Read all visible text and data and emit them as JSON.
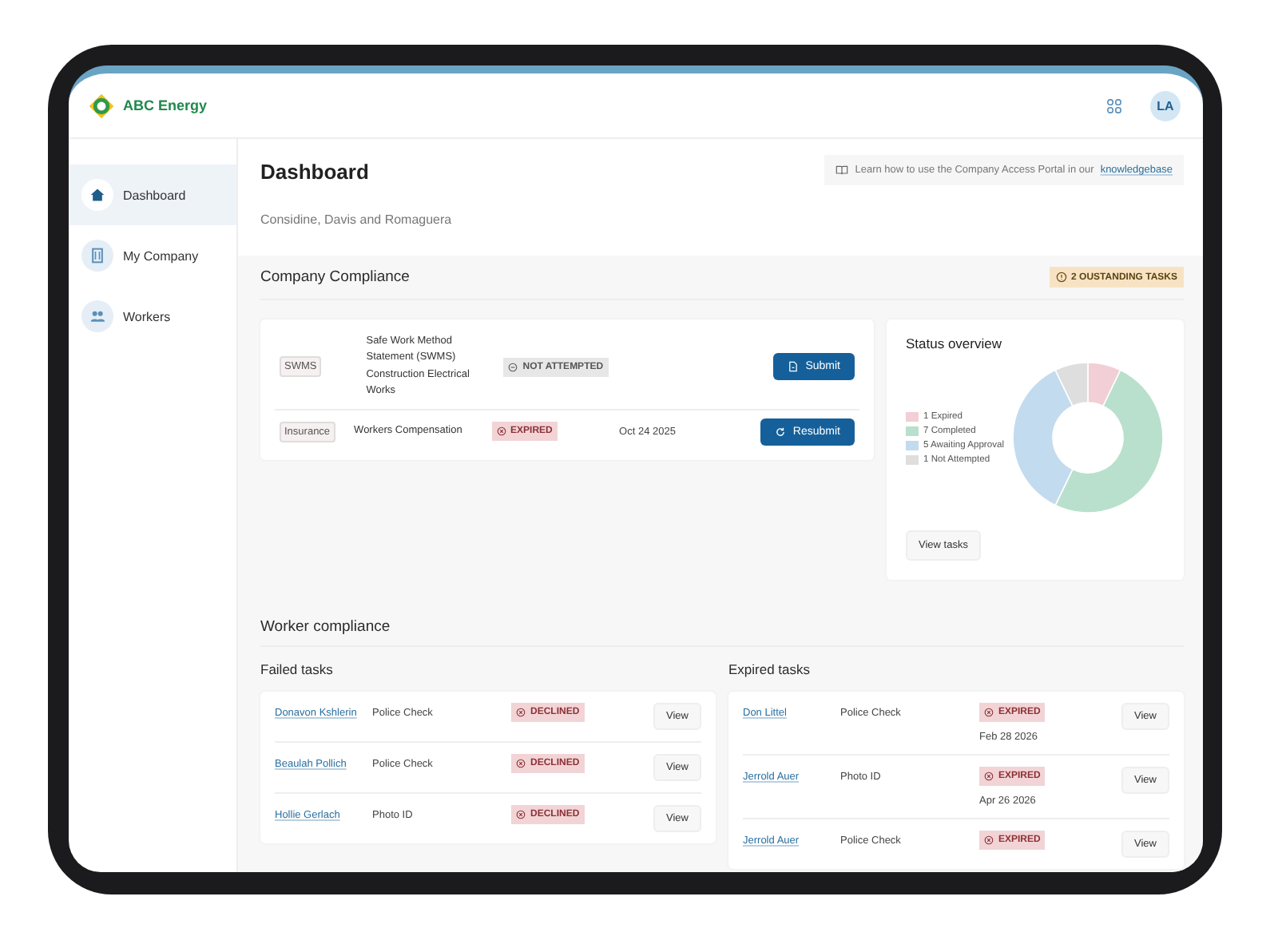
{
  "brand": {
    "name": "ABC Energy"
  },
  "user": {
    "initials": "LA"
  },
  "sidebar": {
    "items": [
      {
        "label": "Dashboard",
        "kind": "home",
        "selected": true
      },
      {
        "label": "My Company",
        "kind": "company",
        "selected": false
      },
      {
        "label": "Workers",
        "kind": "workers",
        "selected": false
      }
    ]
  },
  "header": {
    "title": "Dashboard",
    "subtitle": "Considine, Davis and Romaguera",
    "help": {
      "text": "Learn how to use the Company Access Portal in our",
      "link": "knowledgebase"
    }
  },
  "company_compliance": {
    "title": "Company Compliance",
    "badge": "2 OUSTANDING TASKS",
    "items": [
      {
        "category": "SWMS",
        "name": "Safe Work Method Statement (SWMS) Construction Electrical Works",
        "status": {
          "label": "NOT ATTEMPTED",
          "kind": "neutral"
        },
        "action": {
          "label": "Submit",
          "kind": "submit"
        }
      },
      {
        "category": "Insurance",
        "name": "Workers Compensation",
        "status": {
          "label": "EXPIRED",
          "kind": "danger"
        },
        "date": "Oct 24 2025",
        "action": {
          "label": "Resubmit",
          "kind": "resubmit"
        }
      }
    ],
    "status_overview": {
      "title": "Status overview",
      "button": "View tasks",
      "chart_data": {
        "type": "donut",
        "legend": "left",
        "categories": [
          "1 Expired",
          "7 Completed",
          "5 Awaiting Approval",
          "1 Not Attempted"
        ],
        "values": [
          1,
          7,
          5,
          1
        ],
        "colors": [
          "#f2cfd5",
          "#b9e0cc",
          "#c3dbef",
          "#dedede"
        ]
      }
    }
  },
  "worker_compliance": {
    "title": "Worker compliance",
    "failed": {
      "title": "Failed tasks",
      "rows": [
        {
          "name": "Donavon Kshlerin",
          "task": "Police Check",
          "status": "DECLINED",
          "action": "View"
        },
        {
          "name": "Beaulah Pollich",
          "task": "Police Check",
          "status": "DECLINED",
          "action": "View"
        },
        {
          "name": "Hollie Gerlach",
          "task": "Photo ID",
          "status": "DECLINED",
          "action": "View"
        }
      ]
    },
    "expired": {
      "title": "Expired tasks",
      "rows": [
        {
          "name": "Don Littel",
          "task": "Police Check",
          "status": "EXPIRED",
          "date": "Feb 28 2026",
          "action": "View"
        },
        {
          "name": "Jerrold Auer",
          "task": "Photo ID",
          "status": "EXPIRED",
          "date": "Apr 26 2026",
          "action": "View"
        },
        {
          "name": "Jerrold Auer",
          "task": "Police Check",
          "status": "EXPIRED",
          "action": "View"
        }
      ]
    }
  }
}
